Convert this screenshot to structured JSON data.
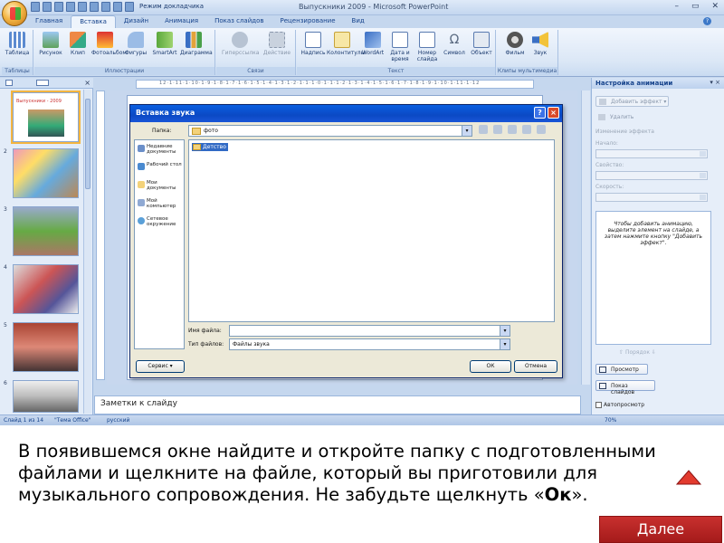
{
  "window": {
    "title": "Выпускники 2009 - Microsoft PowerPoint",
    "mode_label": "Режим докладчика",
    "controls": [
      "–",
      "▭",
      "✕"
    ]
  },
  "ribbon": {
    "tabs": [
      "Главная",
      "Вставка",
      "Дизайн",
      "Анимация",
      "Показ слайдов",
      "Рецензирование",
      "Вид"
    ],
    "active_tab": "Вставка",
    "groups": {
      "tables": {
        "label": "Таблицы",
        "buttons": [
          "Таблица"
        ]
      },
      "illustrations": {
        "label": "Иллюстрации",
        "buttons": [
          "Рисунок",
          "Клип",
          "Фотоальбом",
          "Фигуры",
          "SmartArt",
          "Диаграмма"
        ]
      },
      "links": {
        "label": "Связи",
        "buttons": [
          "Гиперссылка",
          "Действие"
        ]
      },
      "text": {
        "label": "Текст",
        "buttons": [
          "Надпись",
          "Колонтитулы",
          "WordArt",
          "Дата и время",
          "Номер слайда",
          "Символ",
          "Объект"
        ]
      },
      "media": {
        "label": "Клипы мультимедиа",
        "buttons": [
          "Фильм",
          "Звук"
        ]
      }
    }
  },
  "slides_pane": {
    "slides": [
      {
        "num": "",
        "caption": "Выпускники - 2009"
      },
      {
        "num": "2",
        "caption": ""
      },
      {
        "num": "3",
        "caption": ""
      },
      {
        "num": "4",
        "caption": ""
      },
      {
        "num": "5",
        "caption": ""
      },
      {
        "num": "6",
        "caption": ""
      }
    ]
  },
  "ruler_text": "12·1·11·1·10·1·9·1·8·1·7·1·6·1·5·1·4·1·3·1·2·1·1·1·0·1·1·1·2·1·3·1·4·1·5·1·6·1·7·1·8·1·9·1·10·1·11·1·12",
  "notes_placeholder": "Заметки к слайду",
  "task_pane": {
    "title": "Настройка анимации",
    "add_effect": "Добавить эффект",
    "remove": "Удалить",
    "modify_label": "Изменение эффекта",
    "start_label": "Начало:",
    "property_label": "Свойство:",
    "speed_label": "Скорость:",
    "hint": "Чтобы добавить анимацию, выделите элемент на слайде, а затем нажмите кнопку \"Добавить эффект\".",
    "reorder": "Порядок",
    "play": "Просмотр",
    "slideshow": "Показ слайдов",
    "autopreview": "Автопросмотр"
  },
  "status_bar": {
    "slide": "Слайд 1 из 14",
    "theme": "\"Тема Office\"",
    "language": "русский",
    "zoom": "70%"
  },
  "dialog": {
    "title": "Вставка звука",
    "look_in_label": "Папка:",
    "look_in_value": "фото",
    "places": [
      "Недавние документы",
      "Рабочий стол",
      "Мои документы",
      "Мой компьютер",
      "Сетевое окружение"
    ],
    "files": [
      "Детство"
    ],
    "filename_label": "Имя файла:",
    "filename_value": "",
    "filetype_label": "Тип файлов:",
    "filetype_value": "Файлы звука",
    "tools_button": "Сервис",
    "ok_button": "ОК",
    "cancel_button": "Отмена"
  },
  "caption": {
    "text": "В появившемся окне найдите и откройте папку с подготовленными  файлами  и щелкните на файле,  который вы приготовили для музыкального сопровождения.   Не забудьте щелкнуть «",
    "bold": "Ок",
    "tail": "»."
  },
  "next_button": "Далее",
  "colors": {
    "accent": "#c8302e",
    "ribbon": "#dbe7f6",
    "dialog_title": "#0b49c4"
  }
}
